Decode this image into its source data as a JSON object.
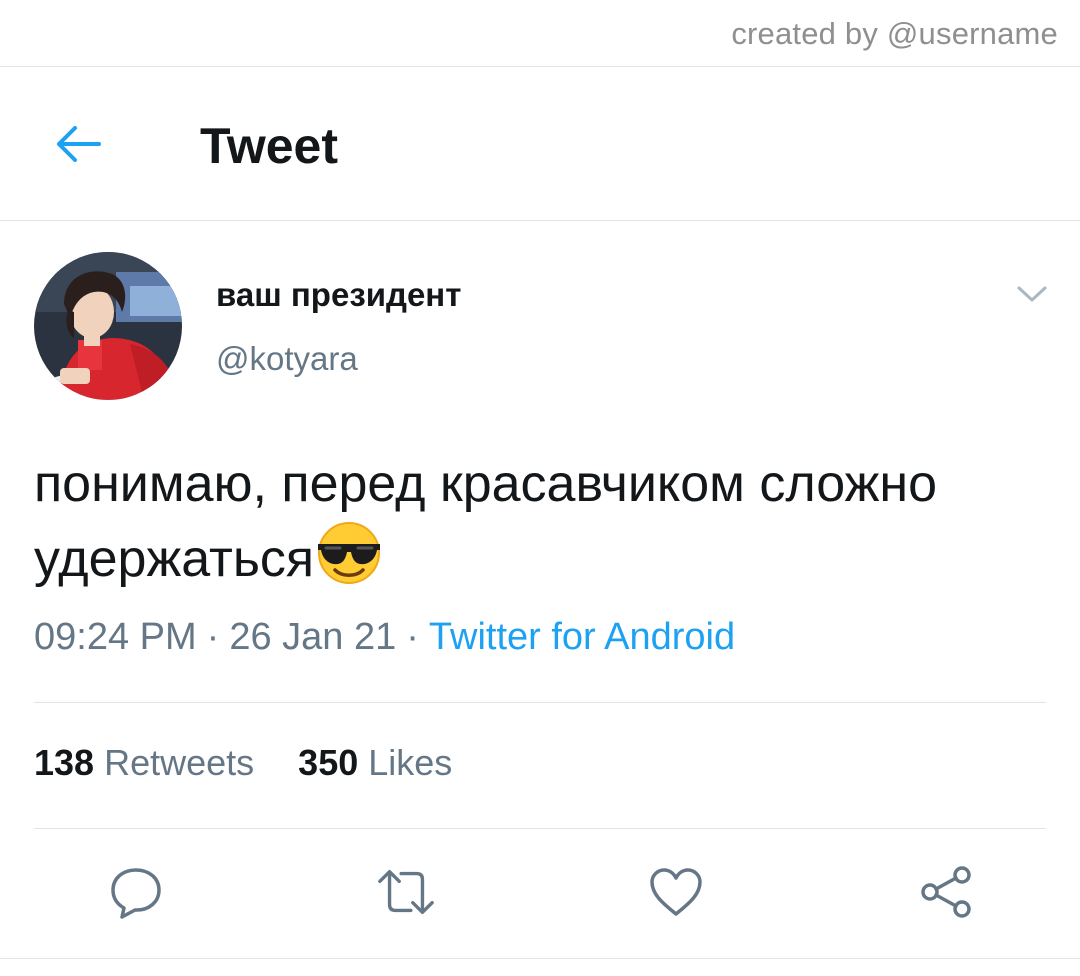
{
  "watermark": "created by @username",
  "header": {
    "title": "Tweet",
    "back_icon": "back-arrow-icon"
  },
  "tweet": {
    "author_name": "ваш президент",
    "author_handle": "@kotyara",
    "text": "понимаю, перед красавчиком сложно удержаться",
    "emoji": "smiling-face-with-sunglasses",
    "time": "09:24 PM",
    "date": "26 Jan 21",
    "separator": "·",
    "source": "Twitter for Android",
    "retweets_count": "138",
    "retweets_label": "Retweets",
    "likes_count": "350",
    "likes_label": "Likes"
  },
  "actions": [
    "reply-icon",
    "retweet-icon",
    "like-icon",
    "share-icon"
  ],
  "colors": {
    "accent": "#1da1f2",
    "secondary_text": "#657786",
    "primary_text": "#14171a",
    "divider": "#e1e4e8",
    "icon_gray": "#657786"
  }
}
